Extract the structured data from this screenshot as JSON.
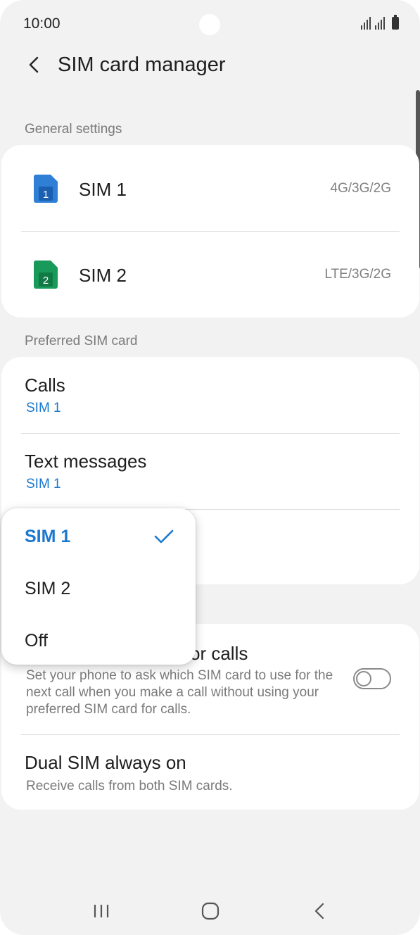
{
  "status_bar": {
    "time": "10:00"
  },
  "header": {
    "title": "SIM card manager"
  },
  "general": {
    "header": "General settings",
    "sims": [
      {
        "label": "SIM 1",
        "number": "1",
        "network": "4G/3G/2G",
        "color": "#2f7fd6"
      },
      {
        "label": "SIM 2",
        "number": "2",
        "network": "LTE/3G/2G",
        "color": "#1a9a5a"
      }
    ]
  },
  "preferred": {
    "header": "Preferred SIM card",
    "calls": {
      "title": "Calls",
      "value": "SIM 1"
    },
    "texts": {
      "title": "Text messages",
      "value": "SIM 1"
    }
  },
  "other": {
    "confirm": {
      "title_visible": "or calls",
      "desc": "Set your phone to ask which SIM card to use for the next call when you make a call without using your preferred SIM card for calls.",
      "enabled": false
    },
    "dual": {
      "title": "Dual SIM always on",
      "desc": "Receive calls from both SIM cards."
    }
  },
  "dropdown": {
    "options": [
      {
        "label": "SIM 1",
        "selected": true
      },
      {
        "label": "SIM 2",
        "selected": false
      },
      {
        "label": "Off",
        "selected": false
      }
    ]
  },
  "colors": {
    "accent": "#1b78d0",
    "background": "#f2f2f2",
    "card": "#ffffff"
  }
}
